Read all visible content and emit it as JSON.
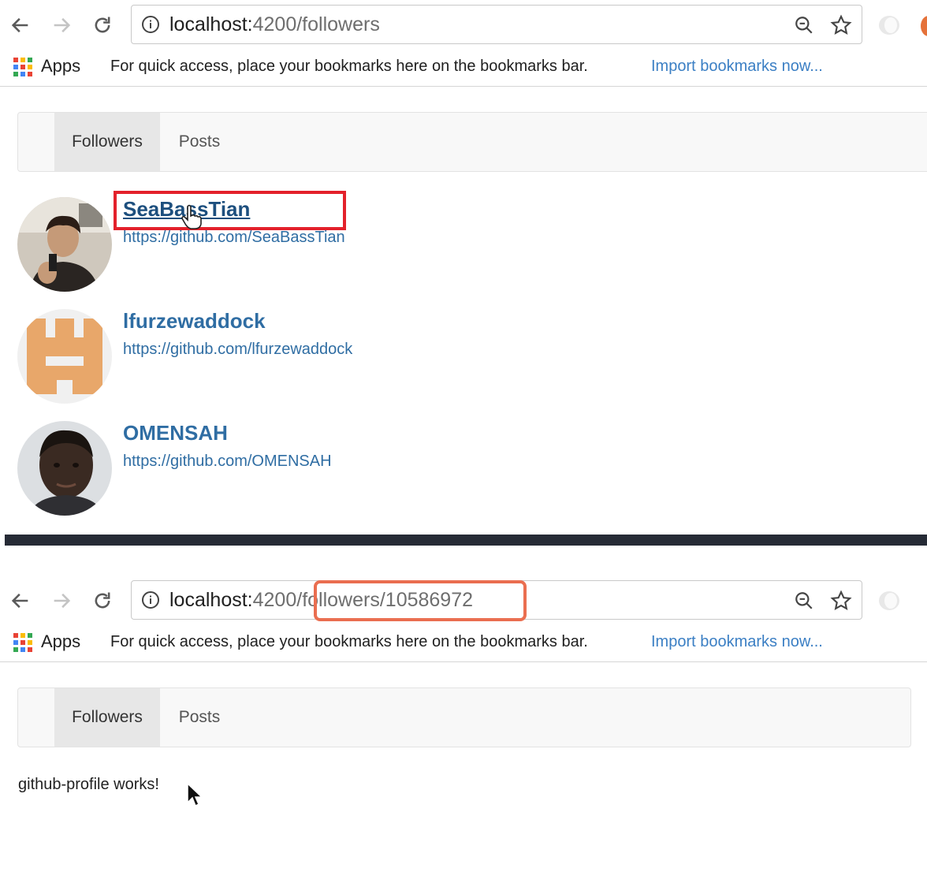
{
  "top": {
    "toolbar": {
      "url_host": "localhost:",
      "url_rest": "4200/followers"
    },
    "bookmarks_bar": {
      "apps_label": "Apps",
      "hint": "For quick access, place your bookmarks here on the bookmarks bar.",
      "import_link": "Import bookmarks now..."
    },
    "navbar": {
      "tabs": [
        {
          "label": "Followers",
          "active": true
        },
        {
          "label": "Posts",
          "active": false
        }
      ]
    },
    "followers": [
      {
        "login": "SeaBassTian",
        "url": "https://github.com/SeaBassTian"
      },
      {
        "login": "lfurzewaddock",
        "url": "https://github.com/lfurzewaddock"
      },
      {
        "login": "OMENSAH",
        "url": "https://github.com/OMENSAH"
      }
    ]
  },
  "bottom": {
    "toolbar": {
      "url_host": "localhost:",
      "url_port": "4200",
      "url_path": "/followers/10586972"
    },
    "bookmarks_bar": {
      "apps_label": "Apps",
      "hint": "For quick access, place your bookmarks here on the bookmarks bar.",
      "import_link": "Import bookmarks now..."
    },
    "navbar": {
      "tabs": [
        {
          "label": "Followers",
          "active": true
        },
        {
          "label": "Posts",
          "active": false
        }
      ]
    },
    "content": "github-profile works!"
  },
  "colors": {
    "link": "#2f6da3",
    "highlight_red": "#e3212b",
    "highlight_orange": "#ea6e50",
    "separator": "#262b36"
  }
}
